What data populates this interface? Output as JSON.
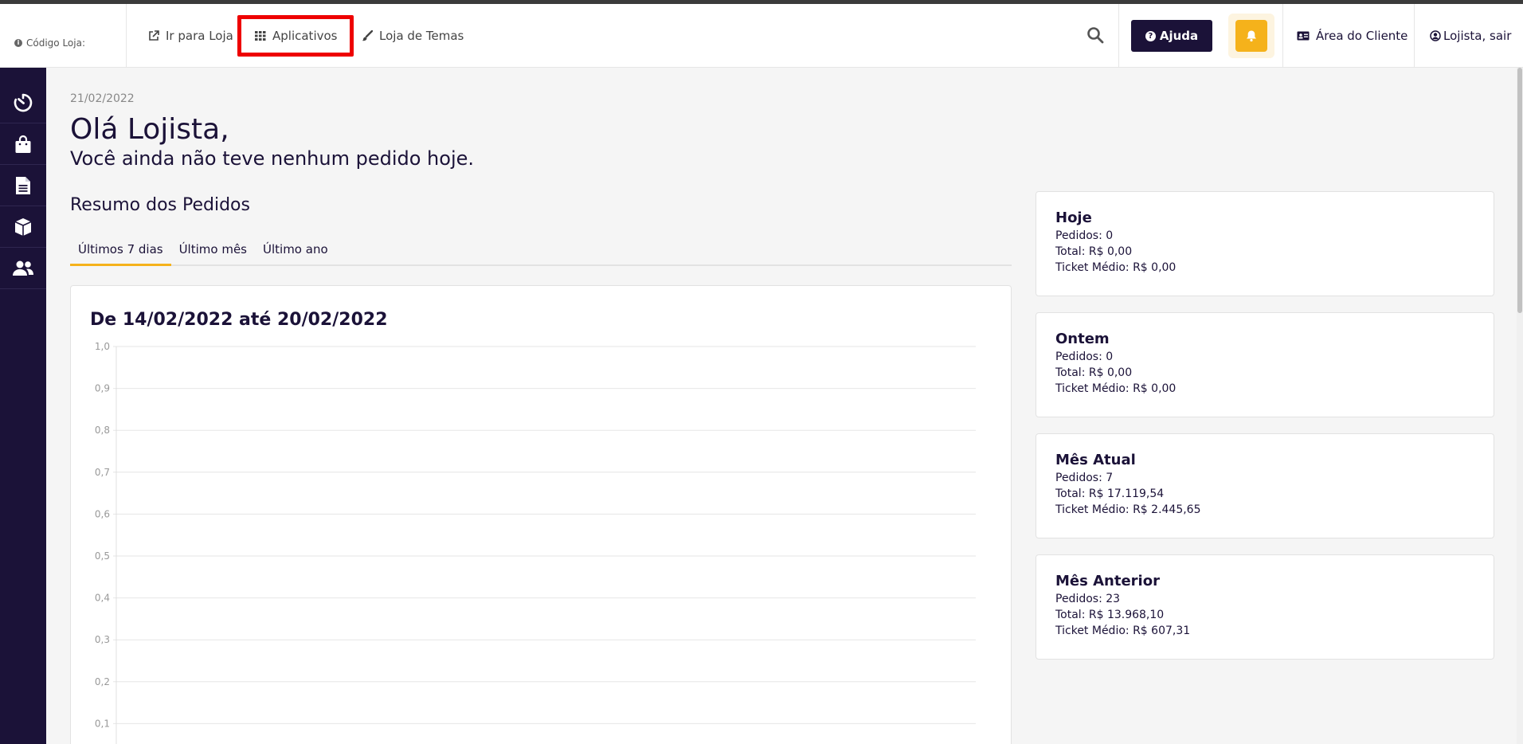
{
  "header": {
    "store_code_label": "Código Loja:",
    "nav": [
      {
        "label": "Ir para Loja",
        "icon": "external-link-icon"
      },
      {
        "label": "Aplicativos",
        "icon": "grid-icon"
      },
      {
        "label": "Loja de Temas",
        "icon": "brush-icon"
      }
    ],
    "help_label": "Ajuda",
    "client_area_label": "Área do Cliente",
    "account_label": "Lojista, sair"
  },
  "sidebar": {
    "items": [
      {
        "icon": "dashboard-timer-icon"
      },
      {
        "icon": "shopping-bag-icon"
      },
      {
        "icon": "document-icon"
      },
      {
        "icon": "box-icon"
      },
      {
        "icon": "users-icon"
      }
    ]
  },
  "main": {
    "date": "21/02/2022",
    "greeting": "Olá Lojista,",
    "subgreeting": "Você ainda não teve nenhum pedido hoje.",
    "section_title": "Resumo dos Pedidos",
    "tabs": [
      {
        "label": "Últimos 7 dias",
        "active": true
      },
      {
        "label": "Último mês",
        "active": false
      },
      {
        "label": "Último ano",
        "active": false
      }
    ]
  },
  "chart_data": {
    "type": "line",
    "title": "De 14/02/2022 até 20/02/2022",
    "y_ticks": [
      "1,0",
      "0,9",
      "0,8",
      "0,7",
      "0,6",
      "0,5",
      "0,4",
      "0,3",
      "0,2",
      "0,1"
    ],
    "ylim": [
      0,
      1
    ],
    "grid": true,
    "series": []
  },
  "stats": [
    {
      "title": "Hoje",
      "orders": "Pedidos: 0",
      "total": "Total: R$ 0,00",
      "ticket": "Ticket Médio: R$ 0,00"
    },
    {
      "title": "Ontem",
      "orders": "Pedidos: 0",
      "total": "Total: R$ 0,00",
      "ticket": "Ticket Médio: R$ 0,00"
    },
    {
      "title": "Mês Atual",
      "orders": "Pedidos: 7",
      "total": "Total: R$ 17.119,54",
      "ticket": "Ticket Médio: R$ 2.445,65"
    },
    {
      "title": "Mês Anterior",
      "orders": "Pedidos: 23",
      "total": "Total: R$ 13.968,10",
      "ticket": "Ticket Médio: R$ 607,31"
    }
  ],
  "colors": {
    "brand_dark": "#1b1238",
    "accent": "#f5b21b",
    "highlight": "#ee0000"
  }
}
